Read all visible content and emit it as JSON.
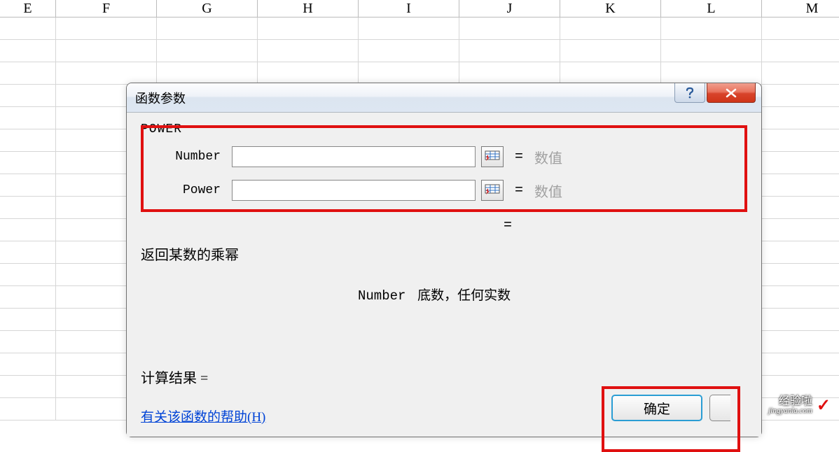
{
  "columns": [
    "E",
    "F",
    "G",
    "H",
    "I",
    "J",
    "K",
    "L",
    "M"
  ],
  "dialog": {
    "title": "函数参数",
    "function_name": "POWER",
    "params": [
      {
        "label": "Number",
        "value": "",
        "hint": "数值"
      },
      {
        "label": "Power",
        "value": "",
        "hint": "数值"
      }
    ],
    "equals_sign": "=",
    "description": "返回某数的乘幂",
    "param_desc": {
      "name": "Number",
      "text": "底数，任何实数"
    },
    "calc_result_label": "计算结果 =",
    "help_link": "有关该函数的帮助(H)",
    "ok_label": "确定"
  },
  "watermark": {
    "cn": "经验啦",
    "en": "jingyanla.com",
    "check": "✓"
  }
}
